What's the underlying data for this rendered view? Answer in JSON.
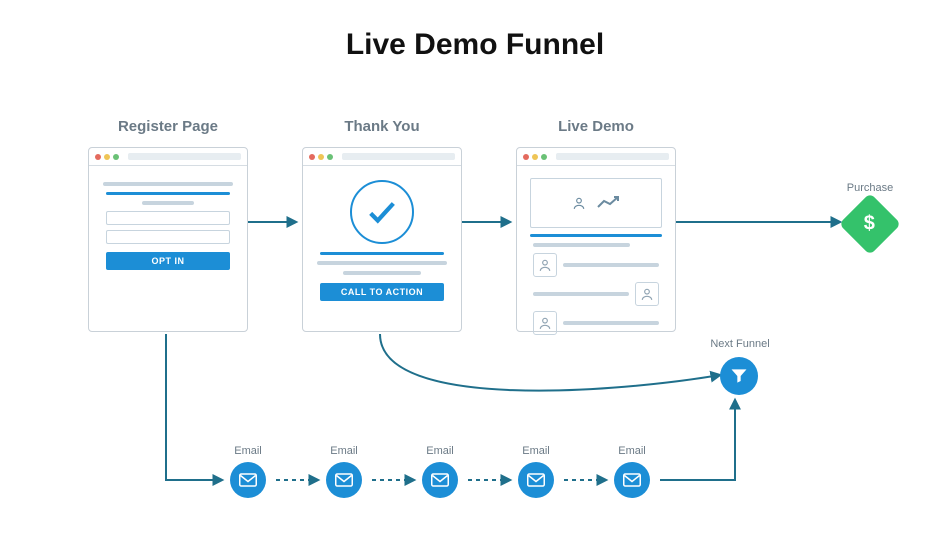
{
  "title": "Live Demo Funnel",
  "steps": {
    "register": {
      "label": "Register Page",
      "button": "OPT IN"
    },
    "thankyou": {
      "label": "Thank You",
      "button": "CALL TO ACTION"
    },
    "livedemo": {
      "label": "Live Demo"
    },
    "purchase": {
      "label": "Purchase",
      "symbol": "$"
    },
    "nextfunnel": {
      "label": "Next Funnel"
    }
  },
  "emails": [
    {
      "label": "Email"
    },
    {
      "label": "Email"
    },
    {
      "label": "Email"
    },
    {
      "label": "Email"
    },
    {
      "label": "Email"
    }
  ]
}
